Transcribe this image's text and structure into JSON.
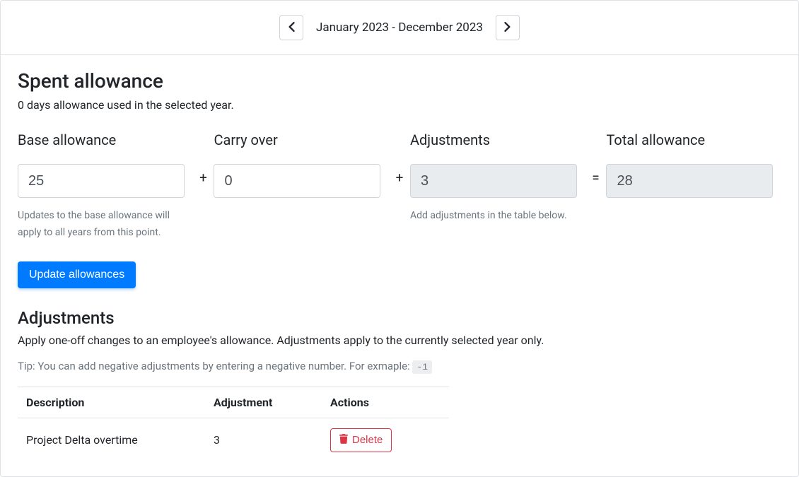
{
  "year_selector": {
    "label": "January 2023 - December 2023"
  },
  "spent": {
    "title": "Spent allowance",
    "subtitle": "0 days allowance used in the selected year."
  },
  "allowance": {
    "base": {
      "label": "Base allowance",
      "value": "25",
      "hint": "Updates to the base allowance will apply to all years from this point."
    },
    "carry": {
      "label": "Carry over",
      "value": "0"
    },
    "adjustments": {
      "label": "Adjustments",
      "value": "3",
      "hint": "Add adjustments in the table below."
    },
    "total": {
      "label": "Total allowance",
      "value": "28"
    },
    "update_button": "Update allowances"
  },
  "adjustments_section": {
    "title": "Adjustments",
    "description": "Apply one-off changes to an employee's allowance. Adjustments apply to the currently selected year only.",
    "tip_prefix": "Tip: You can add negative adjustments by entering a negative number. For exmaple: ",
    "tip_code": "-1",
    "columns": {
      "description": "Description",
      "adjustment": "Adjustment",
      "actions": "Actions"
    },
    "rows": [
      {
        "description": "Project Delta overtime",
        "adjustment": "3",
        "delete_label": "Delete"
      }
    ]
  }
}
